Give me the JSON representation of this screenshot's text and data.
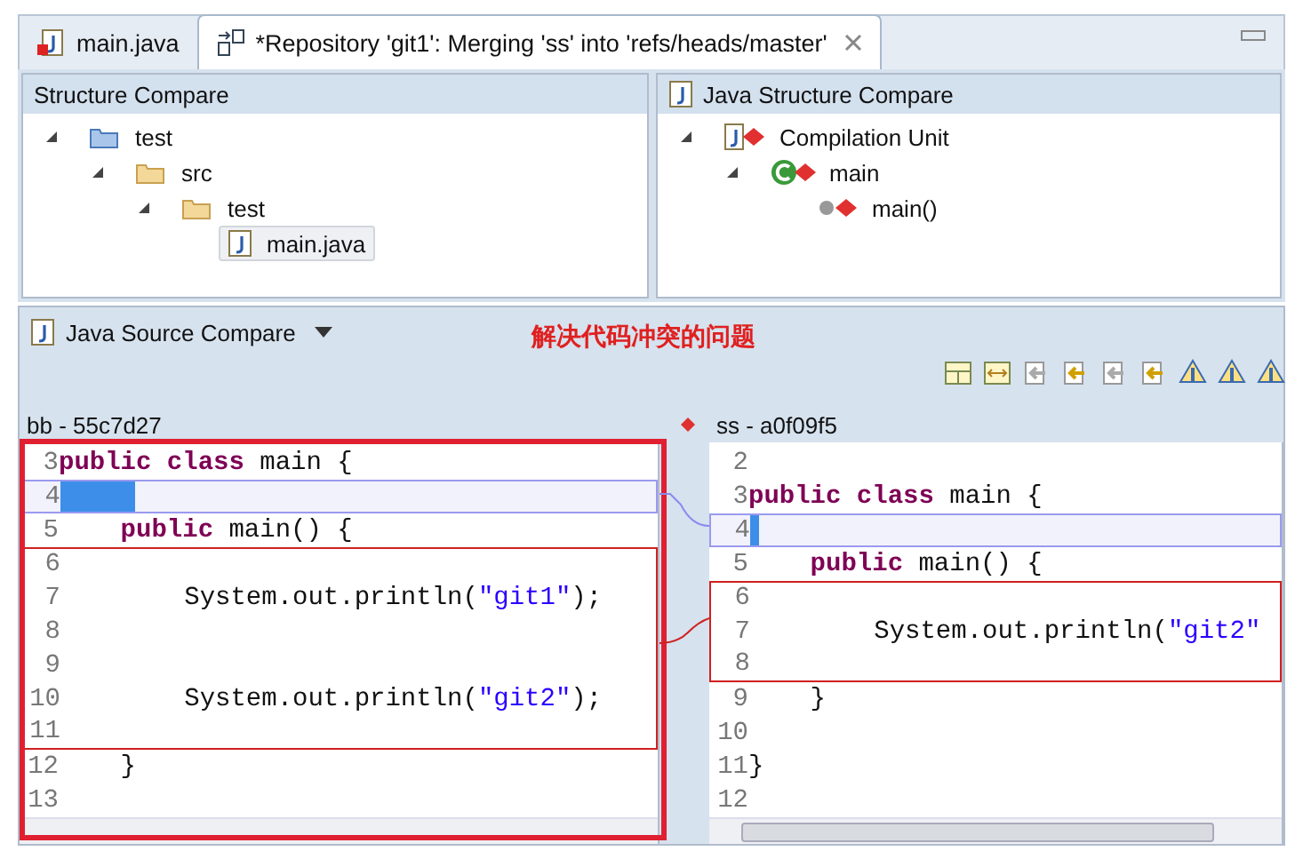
{
  "tabs": [
    {
      "label": "main.java",
      "kind": "java",
      "selected": false
    },
    {
      "label": "*Repository 'git1': Merging 'ss' into 'refs/heads/master'",
      "kind": "merge",
      "selected": true
    }
  ],
  "structure_compare": {
    "title": "Structure Compare",
    "tree": [
      {
        "label": "test",
        "kind": "project",
        "expanded": true,
        "selected": false,
        "children": [
          {
            "label": "src",
            "kind": "folder",
            "expanded": true,
            "selected": false,
            "children": [
              {
                "label": "test",
                "kind": "folder",
                "expanded": true,
                "selected": false,
                "children": [
                  {
                    "label": "main.java",
                    "kind": "java",
                    "selected": true
                  }
                ]
              }
            ]
          }
        ]
      }
    ]
  },
  "java_structure_compare": {
    "title": "Java Structure Compare",
    "tree": [
      {
        "label": "Compilation Unit",
        "kind": "unit",
        "expanded": true,
        "children": [
          {
            "label": "main",
            "kind": "class",
            "expanded": true,
            "children": [
              {
                "label": "main()",
                "kind": "method"
              }
            ]
          }
        ]
      }
    ]
  },
  "source_compare": {
    "title": "Java Source Compare",
    "annotation": "解决代码冲突的问题",
    "left": {
      "title": "bb - 55c7d27",
      "lines": [
        {
          "n": "3",
          "changed": false,
          "conflict": false,
          "code": [
            {
              "t": "public class",
              "kind": "keyword"
            },
            {
              "t": " main {",
              "kind": "plain"
            }
          ]
        },
        {
          "n": "4",
          "changed": true,
          "conflict": false
        },
        {
          "n": "5",
          "changed": false,
          "conflict": false,
          "code": [
            {
              "t": "    public",
              "kind": "keyword"
            },
            {
              "t": " main() {",
              "kind": "plain"
            }
          ]
        },
        {
          "n": "6",
          "changed": false,
          "conflict": true
        },
        {
          "n": "7",
          "changed": false,
          "conflict": true,
          "code": [
            {
              "t": "        System.out.println(",
              "kind": "plain"
            },
            {
              "t": "\"git1\"",
              "kind": "string"
            },
            {
              "t": ");",
              "kind": "plain"
            }
          ]
        },
        {
          "n": "8",
          "changed": false,
          "conflict": true
        },
        {
          "n": "9",
          "changed": false,
          "conflict": true
        },
        {
          "n": "10",
          "changed": false,
          "conflict": true,
          "code": [
            {
              "t": "        System.out.println(",
              "kind": "plain"
            },
            {
              "t": "\"git2\"",
              "kind": "string"
            },
            {
              "t": ");",
              "kind": "plain"
            }
          ]
        },
        {
          "n": "11",
          "changed": false,
          "conflict": true
        },
        {
          "n": "12",
          "changed": false,
          "conflict": false,
          "code": [
            {
              "t": "    }",
              "kind": "plain"
            }
          ]
        },
        {
          "n": "13",
          "changed": false,
          "conflict": false
        }
      ]
    },
    "right": {
      "title": "ss - a0f09f5",
      "lines": [
        {
          "n": "2",
          "changed": false,
          "conflict": false
        },
        {
          "n": "3",
          "changed": false,
          "conflict": false,
          "code": [
            {
              "t": "public class",
              "kind": "keyword"
            },
            {
              "t": " main {",
              "kind": "plain"
            }
          ]
        },
        {
          "n": "4",
          "changed": true,
          "conflict": false
        },
        {
          "n": "5",
          "changed": false,
          "conflict": false,
          "code": [
            {
              "t": "    public",
              "kind": "keyword"
            },
            {
              "t": " main() {",
              "kind": "plain"
            }
          ]
        },
        {
          "n": "6",
          "changed": false,
          "conflict": true
        },
        {
          "n": "7",
          "changed": false,
          "conflict": true,
          "code": [
            {
              "t": "        System.out.println(",
              "kind": "plain"
            },
            {
              "t": "\"git2\"",
              "kind": "string"
            }
          ]
        },
        {
          "n": "8",
          "changed": false,
          "conflict": true
        },
        {
          "n": "9",
          "changed": false,
          "conflict": false,
          "code": [
            {
              "t": "    }",
              "kind": "plain"
            }
          ]
        },
        {
          "n": "10",
          "changed": false,
          "conflict": false
        },
        {
          "n": "11",
          "changed": false,
          "conflict": false,
          "code": [
            {
              "t": "}",
              "kind": "plain"
            }
          ]
        },
        {
          "n": "12",
          "changed": false,
          "conflict": false
        }
      ]
    }
  }
}
